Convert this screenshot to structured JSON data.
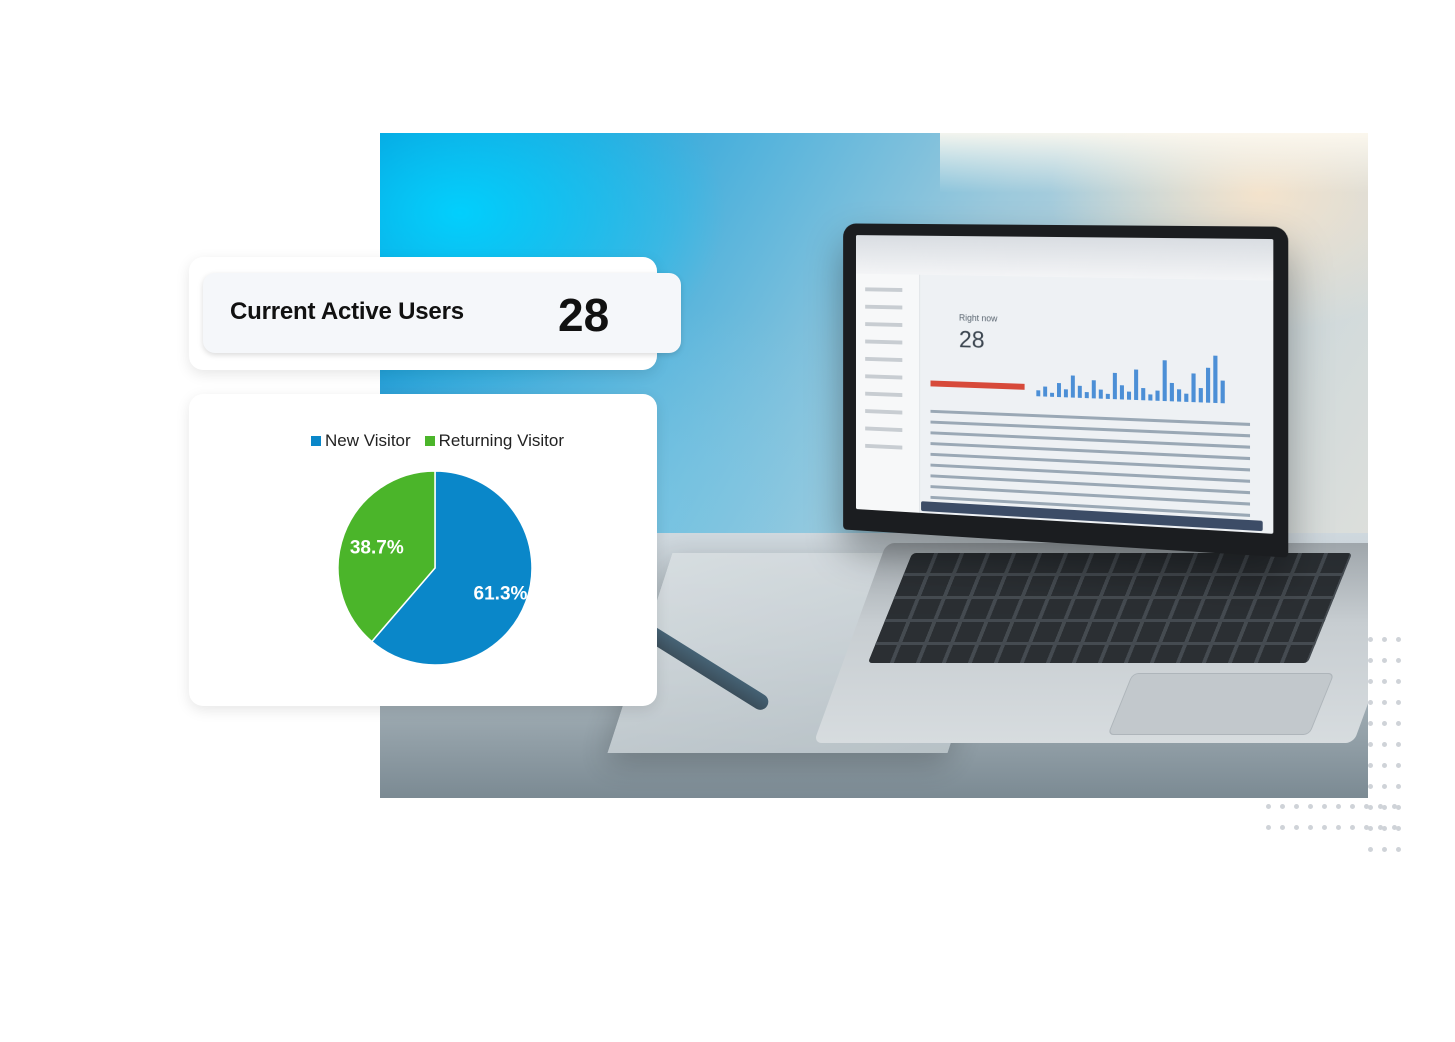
{
  "active_users_card": {
    "label": "Current Active Users",
    "value": "28"
  },
  "screen_readout": {
    "label": "Right now",
    "value": "28"
  },
  "colors": {
    "new_visitor": "#0a87c9",
    "returning_visitor": "#4bb52a",
    "card_background": "#ffffff",
    "card_inner_background": "#f5f7fa"
  },
  "chart_data": {
    "type": "pie",
    "title": "",
    "legend_position": "top",
    "categories": [
      "New Visitor",
      "Returning Visitor"
    ],
    "values": [
      61.3,
      38.7
    ],
    "labels": [
      "61.3%",
      "38.7%"
    ],
    "colors": [
      "#0a87c9",
      "#4bb52a"
    ]
  },
  "icons": {
    "decoration": "dot-grid"
  }
}
